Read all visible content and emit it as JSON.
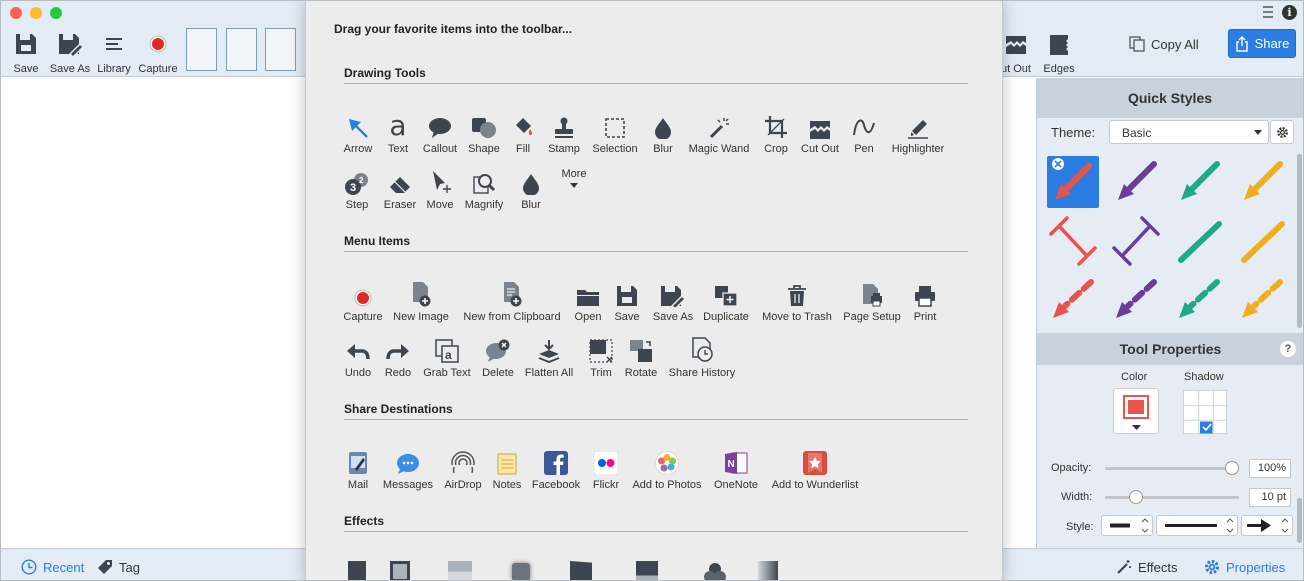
{
  "toolbar": {
    "left_buttons": [
      {
        "label": "Save",
        "icon": "save-icon"
      },
      {
        "label": "Save As",
        "icon": "save-as-icon"
      },
      {
        "label": "Library",
        "icon": "library-icon"
      },
      {
        "label": "Capture",
        "icon": "capture-icon"
      }
    ],
    "right_buttons": [
      {
        "label": "ut Out",
        "icon": "cut-out-icon"
      },
      {
        "label": "Edges",
        "icon": "edges-icon"
      }
    ],
    "copy_all_label": "Copy All",
    "share_label": "Share"
  },
  "bottom_bar": {
    "recent_label": "Recent",
    "tag_label": "Tag",
    "effects_label": "Effects",
    "properties_label": "Properties"
  },
  "right_panel": {
    "quick_styles_title": "Quick Styles",
    "theme_label": "Theme:",
    "theme_value": "Basic",
    "tool_properties_title": "Tool Properties",
    "help_symbol": "?",
    "color_label": "Color",
    "shadow_label": "Shadow",
    "opacity_label": "Opacity:",
    "opacity_value": "100%",
    "opacity_level": 1.0,
    "width_label": "Width:",
    "width_value": "10 pt",
    "width_level": 0.2,
    "style_label": "Style:",
    "accent_red": "#e8534a",
    "accent_purple": "#6a3d9a",
    "accent_teal": "#1fa88a",
    "accent_yellow": "#f0ad1e",
    "selected_bg": "#2b7de1"
  },
  "dialog": {
    "title": "Drag your favorite items into the toolbar...",
    "sections": {
      "drawing_tools": "Drawing Tools",
      "menu_items": "Menu Items",
      "share_destinations": "Share Destinations",
      "effects": "Effects"
    },
    "drawing_tools": [
      {
        "label": "Arrow",
        "icon": "arrow-icon"
      },
      {
        "label": "Text",
        "icon": "text-icon"
      },
      {
        "label": "Callout",
        "icon": "callout-icon"
      },
      {
        "label": "Shape",
        "icon": "shape-icon"
      },
      {
        "label": "Fill",
        "icon": "fill-icon"
      },
      {
        "label": "Stamp",
        "icon": "stamp-icon"
      },
      {
        "label": "Selection",
        "icon": "selection-icon"
      },
      {
        "label": "Blur",
        "icon": "blur-icon"
      },
      {
        "label": "Magic Wand",
        "icon": "magic-wand-icon"
      },
      {
        "label": "Crop",
        "icon": "crop-icon"
      },
      {
        "label": "Cut Out",
        "icon": "cut-out-icon"
      },
      {
        "label": "Pen",
        "icon": "pen-icon"
      },
      {
        "label": "Highlighter",
        "icon": "highlighter-icon"
      },
      {
        "label": "Step",
        "icon": "step-icon"
      },
      {
        "label": "Eraser",
        "icon": "eraser-icon"
      },
      {
        "label": "Move",
        "icon": "move-icon"
      },
      {
        "label": "Magnify",
        "icon": "magnify-icon"
      },
      {
        "label": "Blur",
        "icon": "blur-icon"
      },
      {
        "label": "More",
        "icon": "chevron-down-icon"
      }
    ],
    "menu_items": [
      {
        "label": "Capture",
        "icon": "capture-icon"
      },
      {
        "label": "New Image",
        "icon": "new-image-icon"
      },
      {
        "label": "New from Clipboard",
        "icon": "new-from-clipboard-icon"
      },
      {
        "label": "Open",
        "icon": "folder-icon"
      },
      {
        "label": "Save",
        "icon": "save-icon"
      },
      {
        "label": "Save As",
        "icon": "save-as-icon"
      },
      {
        "label": "Duplicate",
        "icon": "duplicate-icon"
      },
      {
        "label": "Move to Trash",
        "icon": "trash-icon"
      },
      {
        "label": "Page Setup",
        "icon": "page-setup-icon"
      },
      {
        "label": "Print",
        "icon": "printer-icon"
      },
      {
        "label": "Undo",
        "icon": "undo-icon"
      },
      {
        "label": "Redo",
        "icon": "redo-icon"
      },
      {
        "label": "Grab Text",
        "icon": "grab-text-icon"
      },
      {
        "label": "Delete",
        "icon": "delete-icon"
      },
      {
        "label": "Flatten All",
        "icon": "flatten-icon"
      },
      {
        "label": "Trim",
        "icon": "trim-icon"
      },
      {
        "label": "Rotate",
        "icon": "rotate-icon"
      },
      {
        "label": "Share History",
        "icon": "share-history-icon"
      }
    ],
    "share_destinations": [
      {
        "label": "Mail",
        "icon": "mail-icon"
      },
      {
        "label": "Messages",
        "icon": "messages-icon"
      },
      {
        "label": "AirDrop",
        "icon": "airdrop-icon"
      },
      {
        "label": "Notes",
        "icon": "notes-icon"
      },
      {
        "label": "Facebook",
        "icon": "facebook-icon"
      },
      {
        "label": "Flickr",
        "icon": "flickr-icon"
      },
      {
        "label": "Add to Photos",
        "icon": "photos-icon"
      },
      {
        "label": "OneNote",
        "icon": "onenote-icon"
      },
      {
        "label": "Add to Wunderlist",
        "icon": "wunderlist-icon"
      }
    ]
  }
}
